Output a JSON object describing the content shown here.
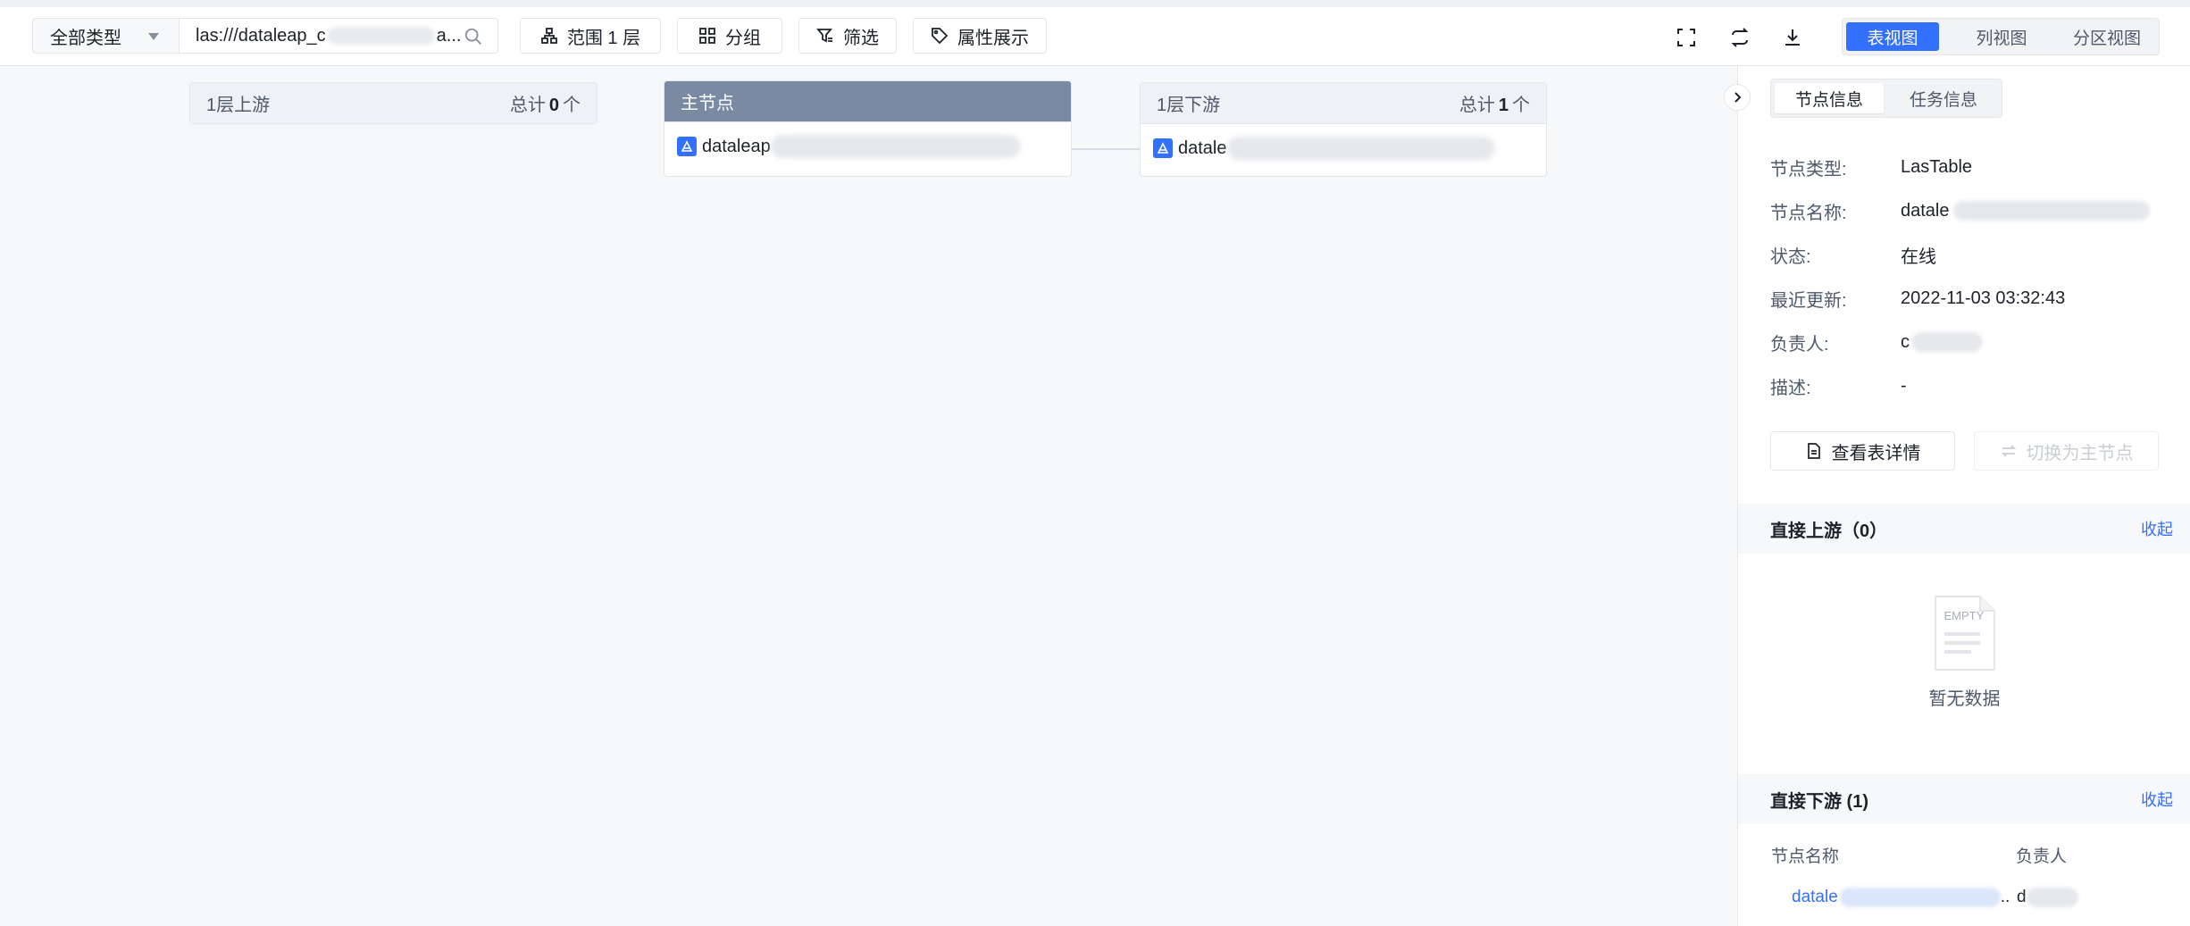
{
  "toolbar": {
    "type_select": "全部类型",
    "search_value_prefix": "las:///dataleap_c",
    "search_value_suffix": "a...",
    "scope_label": "范围 1 层",
    "group_label": "分组",
    "filter_label": "筛选",
    "attr_label": "属性展示",
    "views": [
      "表视图",
      "列视图",
      "分区视图"
    ],
    "active_view": "表视图"
  },
  "graph": {
    "upstream": {
      "title": "1层上游",
      "total_prefix": "总计",
      "total": "0",
      "total_suffix": "个"
    },
    "main": {
      "title": "主节点",
      "node_name": "dataleap"
    },
    "downstream": {
      "title": "1层下游",
      "total_prefix": "总计",
      "total": "1",
      "total_suffix": "个",
      "node_name": "datale"
    }
  },
  "panel": {
    "tabs": [
      "节点信息",
      "任务信息"
    ],
    "active_tab": "节点信息",
    "fields": [
      {
        "label": "节点类型:",
        "value": "LasTable"
      },
      {
        "label": "节点名称:",
        "value": "datale"
      },
      {
        "label": "状态:",
        "value": "在线"
      },
      {
        "label": "最近更新:",
        "value": "2022-11-03 03:32:43"
      },
      {
        "label": "负责人:",
        "value": "c"
      },
      {
        "label": "描述:",
        "value": "-"
      }
    ],
    "view_detail_label": "查看表详情",
    "switch_main_label": "切换为主节点",
    "upstream_title": "直接上游（0）",
    "upstream_collapse": "收起",
    "empty_badge": "EMPTY",
    "empty_text": "暂无数据",
    "downstream_title": "直接下游 (1)",
    "downstream_collapse": "收起",
    "table_headers": [
      "节点名称",
      "负责人"
    ],
    "table_rows": [
      {
        "name": "datale",
        "name_suffix": "..",
        "owner": "d"
      }
    ]
  }
}
